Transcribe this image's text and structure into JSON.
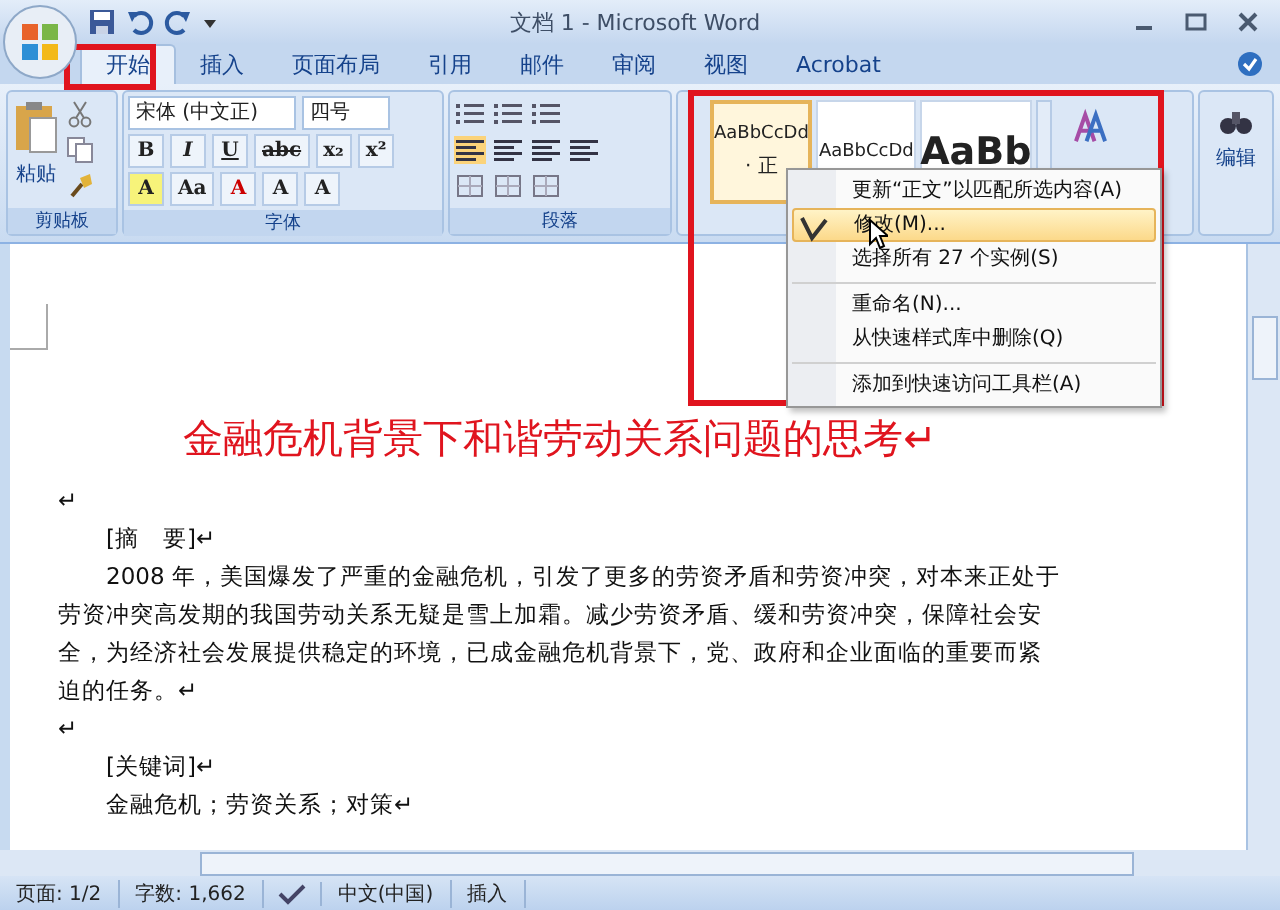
{
  "window": {
    "title": "文档 1 - Microsoft Word"
  },
  "tabs": [
    {
      "label": "开始",
      "selected": true
    },
    {
      "label": "插入",
      "selected": false
    },
    {
      "label": "页面布局",
      "selected": false
    },
    {
      "label": "引用",
      "selected": false
    },
    {
      "label": "邮件",
      "selected": false
    },
    {
      "label": "审阅",
      "selected": false
    },
    {
      "label": "视图",
      "selected": false
    },
    {
      "label": "Acrobat",
      "selected": false
    }
  ],
  "ribbon": {
    "clipboard": {
      "paste_label": "粘贴",
      "group_label": "剪贴板"
    },
    "font": {
      "font_name": "宋体 (中文正)",
      "font_size": "四号",
      "row_1": [
        "B",
        "I",
        "U",
        "abc",
        "x₂",
        "x²"
      ],
      "row_2": [
        "A",
        "Aa",
        "A",
        "A",
        "A"
      ],
      "group_label": "字体"
    },
    "paragraph": {
      "group_label": "段落"
    },
    "styles": [
      {
        "preview": "AaBbCcDd",
        "label": "· 正",
        "selected": true,
        "kind": "small"
      },
      {
        "preview": "AaBbCcDd",
        "selected": false,
        "kind": "small"
      },
      {
        "preview": "AaBb",
        "selected": false,
        "kind": "large"
      }
    ],
    "editing": {
      "label": "编辑"
    }
  },
  "context_menu": [
    {
      "label": "更新“正文”以匹配所选内容(A)",
      "highlighted": false,
      "separator_before": false
    },
    {
      "label": "修改(M)...",
      "highlighted": true,
      "separator_before": false
    },
    {
      "label": "选择所有 27 个实例(S)",
      "highlighted": false,
      "separator_before": false
    },
    {
      "label": "重命名(N)...",
      "highlighted": false,
      "separator_before": true
    },
    {
      "label": "从快速样式库中删除(Q)",
      "highlighted": false,
      "separator_before": false
    },
    {
      "label": "添加到快速访问工具栏(A)",
      "highlighted": false,
      "separator_before": true
    }
  ],
  "document": {
    "title": "金融危机背景下和谐劳动关系问题的思考↵",
    "paragraphs": [
      {
        "text": "↵",
        "indent": false
      },
      {
        "text": "[摘　要]↵",
        "indent": true
      },
      {
        "text": "2008 年，美国爆发了严重的金融危机，引发了更多的劳资矛盾和劳资冲突，对本来正处于劳资冲突高发期的我国劳动关系无疑是雪上加霜。减少劳资矛盾、缓和劳资冲突，保障社会安全，为经济社会发展提供稳定的环境，已成金融危机背景下，党、政府和企业面临的重要而紧迫的任务。↵",
        "indent": true
      },
      {
        "text": "↵",
        "indent": false
      },
      {
        "text": "[关键词]↵",
        "indent": true
      },
      {
        "text": "金融危机；劳资关系；对策↵",
        "indent": true
      }
    ]
  },
  "status_bar": {
    "page": "页面: 1/2",
    "words": "字数: 1,662",
    "language": "中文(中国)",
    "mode": "插入"
  }
}
